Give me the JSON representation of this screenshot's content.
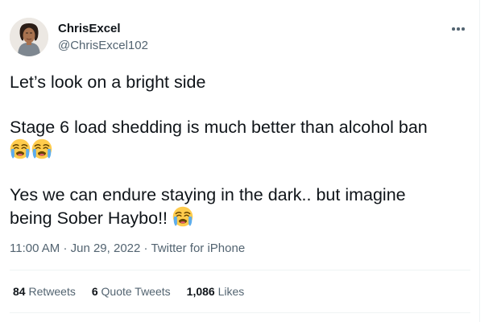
{
  "tweet": {
    "author": {
      "display_name": "ChrisExcel",
      "handle": "@ChrisExcel102"
    },
    "lines": [
      "Let’s look on a bright side",
      "Stage 6 load shedding is much better than alcohol ban",
      "Yes we can endure staying in the dark.. but imagine",
      "being Sober Haybo!!"
    ],
    "emoji": "loudly-crying-face",
    "meta": {
      "time": "11:00 AM",
      "separator": "·",
      "date": "Jun 29, 2022",
      "source": "Twitter for iPhone"
    },
    "stats": {
      "retweets": {
        "count": "84",
        "label": "Retweets"
      },
      "quote_tweets": {
        "count": "6",
        "label": "Quote Tweets"
      },
      "likes": {
        "count": "1,086",
        "label": "Likes"
      }
    }
  },
  "colors": {
    "text_primary": "#0f1419",
    "text_secondary": "#536471",
    "divider": "#eff3f4"
  }
}
